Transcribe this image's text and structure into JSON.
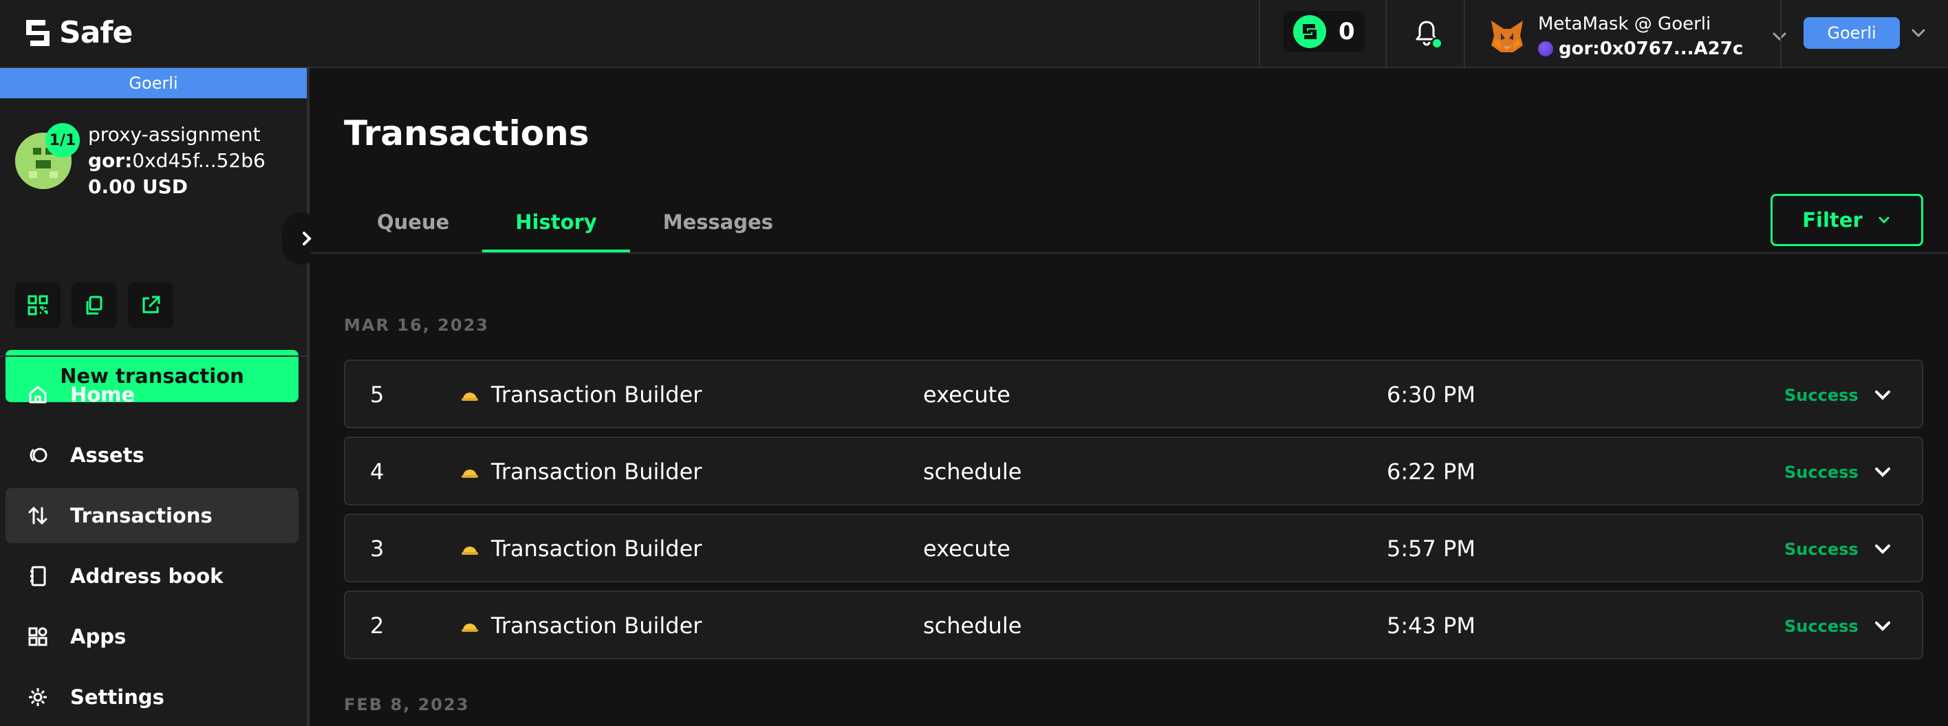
{
  "header": {
    "logo_text": "Safe",
    "token_count": "0",
    "wallet": {
      "name": "MetaMask @ Goerli",
      "address": "gor:0x0767...A27c"
    },
    "network": "Goerli"
  },
  "sidebar": {
    "network_banner": "Goerli",
    "safe": {
      "threshold": "1/1",
      "name": "proxy-assignment",
      "address_prefix": "gor:",
      "address": "0xd45f...52b6",
      "balance": "0.00 USD"
    },
    "new_transaction_label": "New transaction",
    "nav": [
      {
        "label": "Home",
        "icon": "home-icon"
      },
      {
        "label": "Assets",
        "icon": "assets-icon"
      },
      {
        "label": "Transactions",
        "icon": "transactions-icon",
        "active": true
      },
      {
        "label": "Address book",
        "icon": "address-book-icon"
      },
      {
        "label": "Apps",
        "icon": "apps-icon"
      },
      {
        "label": "Settings",
        "icon": "settings-icon"
      }
    ]
  },
  "main": {
    "title": "Transactions",
    "tabs": [
      {
        "label": "Queue"
      },
      {
        "label": "History",
        "active": true
      },
      {
        "label": "Messages"
      }
    ],
    "filter_label": "Filter",
    "groups": [
      {
        "date": "MAR 16, 2023",
        "transactions": [
          {
            "nonce": "5",
            "app": "Transaction Builder",
            "method": "execute",
            "time": "6:30 PM",
            "status": "Success"
          },
          {
            "nonce": "4",
            "app": "Transaction Builder",
            "method": "schedule",
            "time": "6:22 PM",
            "status": "Success"
          },
          {
            "nonce": "3",
            "app": "Transaction Builder",
            "method": "execute",
            "time": "5:57 PM",
            "status": "Success"
          },
          {
            "nonce": "2",
            "app": "Transaction Builder",
            "method": "schedule",
            "time": "5:43 PM",
            "status": "Success"
          }
        ]
      },
      {
        "date": "FEB 8, 2023",
        "transactions": []
      }
    ]
  },
  "colors": {
    "accent": "#12ff80",
    "background": "#121312",
    "panel": "#1c1c1c",
    "network": "#4c8ff0",
    "success": "#00b460"
  }
}
